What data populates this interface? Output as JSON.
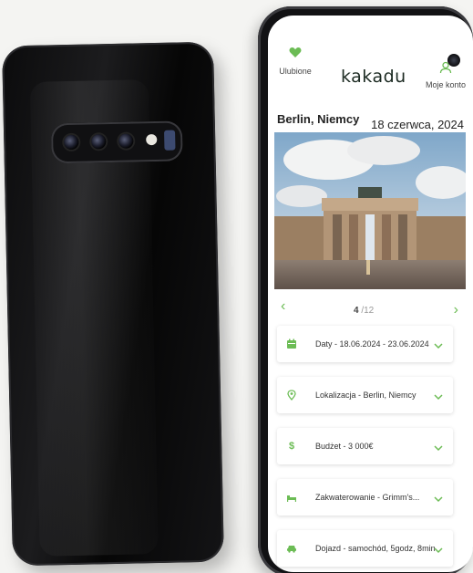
{
  "app": {
    "logo": "kakadu",
    "nav_favorites_label": "Ulubione",
    "nav_account_label": "Moje konto",
    "accent_color": "#6cbc55"
  },
  "trip": {
    "city": "Berlin, Niemcy",
    "date": "18 czerwca, 2024"
  },
  "pager": {
    "current": "4",
    "total": "/12",
    "prev_icon": "chevron-left-icon",
    "next_icon": "chevron-right-icon"
  },
  "details": [
    {
      "icon": "calendar-icon",
      "label": "Daty - 18.06.2024 - 23.06.2024"
    },
    {
      "icon": "location-pin-icon",
      "label": "Lokalizacja - Berlin, Niemcy"
    },
    {
      "icon": "dollar-icon",
      "label": "Budżet - 3 000€"
    },
    {
      "icon": "bed-icon",
      "label": "Zakwaterowanie - Grimm's..."
    },
    {
      "icon": "car-icon",
      "label": "Dojazd - samochód, 5godz, 8min"
    }
  ]
}
